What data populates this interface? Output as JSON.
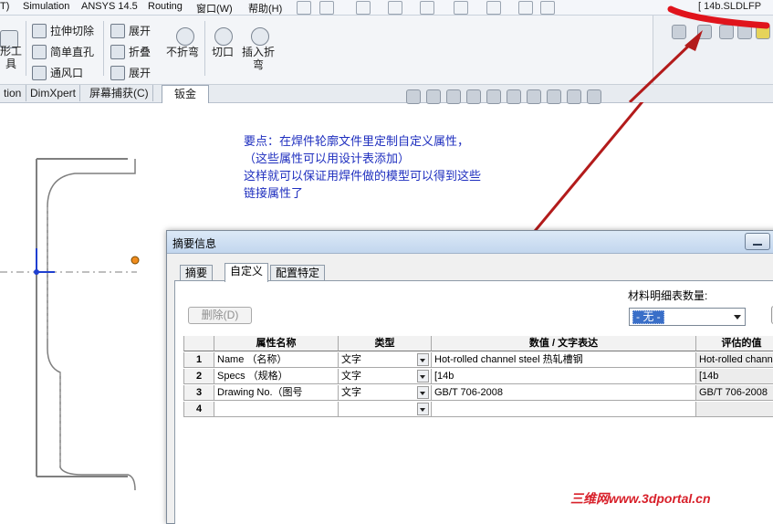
{
  "menu": [
    "T)",
    "Simulation",
    "ANSYS 14.5",
    "Routing",
    "窗口(W)",
    "帮助(H)"
  ],
  "document_title": "[ 14b.SLDLFP",
  "ribbon": {
    "col1_top": "形工",
    "col1_bottom": "具",
    "extruded_cut": "拉伸切除",
    "simple_hole": "简单直孔",
    "vent": "通风口",
    "unfold": "展开",
    "fold": "折叠",
    "flatten": "展开",
    "no_bends": "不折弯",
    "cut": "切口",
    "insert_bends_1": "插入折",
    "insert_bends_2": "弯"
  },
  "command_tabs": [
    "tion",
    "DimXpert",
    "屏幕捕获(C)",
    "钣金"
  ],
  "note_lines": [
    "要点：在焊件轮廓文件里定制自定义属性，",
    "（这些属性可以用设计表添加）",
    "这样就可以保证用焊件做的模型可以得到这些",
    "链接属性了"
  ],
  "dialog": {
    "title": "摘要信息",
    "tabs": [
      "摘要",
      "自定义",
      "配置特定"
    ],
    "delete_button": "删除(D)",
    "bom_qty_label": "材料明细表数量:",
    "bom_qty_value": "- 无 -",
    "columns": [
      "属性名称",
      "类型",
      "数值 / 文字表达",
      "评估的值"
    ],
    "rows": [
      {
        "n": "1",
        "name": "Name （名称）",
        "type": "文字",
        "value": "Hot-rolled channel steel 热轧槽钢",
        "evaluated": "Hot-rolled channel"
      },
      {
        "n": "2",
        "name": "Specs （规格）",
        "type": "文字",
        "value": "[14b",
        "evaluated": "[14b"
      },
      {
        "n": "3",
        "name": "Drawing No.（图号",
        "type": "文字",
        "value": "GB/T 706-2008",
        "evaluated": "GB/T 706-2008"
      },
      {
        "n": "4",
        "name": "",
        "type": "",
        "value": "",
        "evaluated": ""
      }
    ]
  },
  "watermark": "三维网www.3dportal.cn",
  "colors": {
    "note": "#1f2fbf",
    "arrow": "#b31b1b",
    "watermark": "#d8202a"
  }
}
